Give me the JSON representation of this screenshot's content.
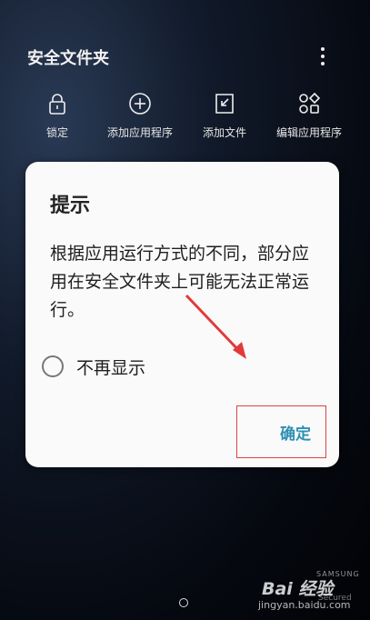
{
  "header": {
    "title": "安全文件夹",
    "more_icon": "more-vert-icon"
  },
  "actions": [
    {
      "label": "锁定",
      "icon": "lock-icon"
    },
    {
      "label": "添加应用程序",
      "icon": "add-circle-icon"
    },
    {
      "label": "添加文件",
      "icon": "add-file-icon"
    },
    {
      "label": "编辑应用程序",
      "icon": "edit-apps-icon"
    }
  ],
  "dialog": {
    "title": "提示",
    "message": "根据应用运行方式的不同，部分应用在安全文件夹上可能无法正常运行。",
    "checkbox_label": "不再显示",
    "checkbox_checked": false,
    "confirm_label": "确定",
    "confirm_color": "#2f8fb2"
  },
  "annotation": {
    "highlight_color": "#d94545"
  },
  "watermark": {
    "logo": "Bai 经验",
    "url": "jingyan.baidu.com",
    "samsung": "SAMSUNG",
    "secured": "Secured"
  }
}
